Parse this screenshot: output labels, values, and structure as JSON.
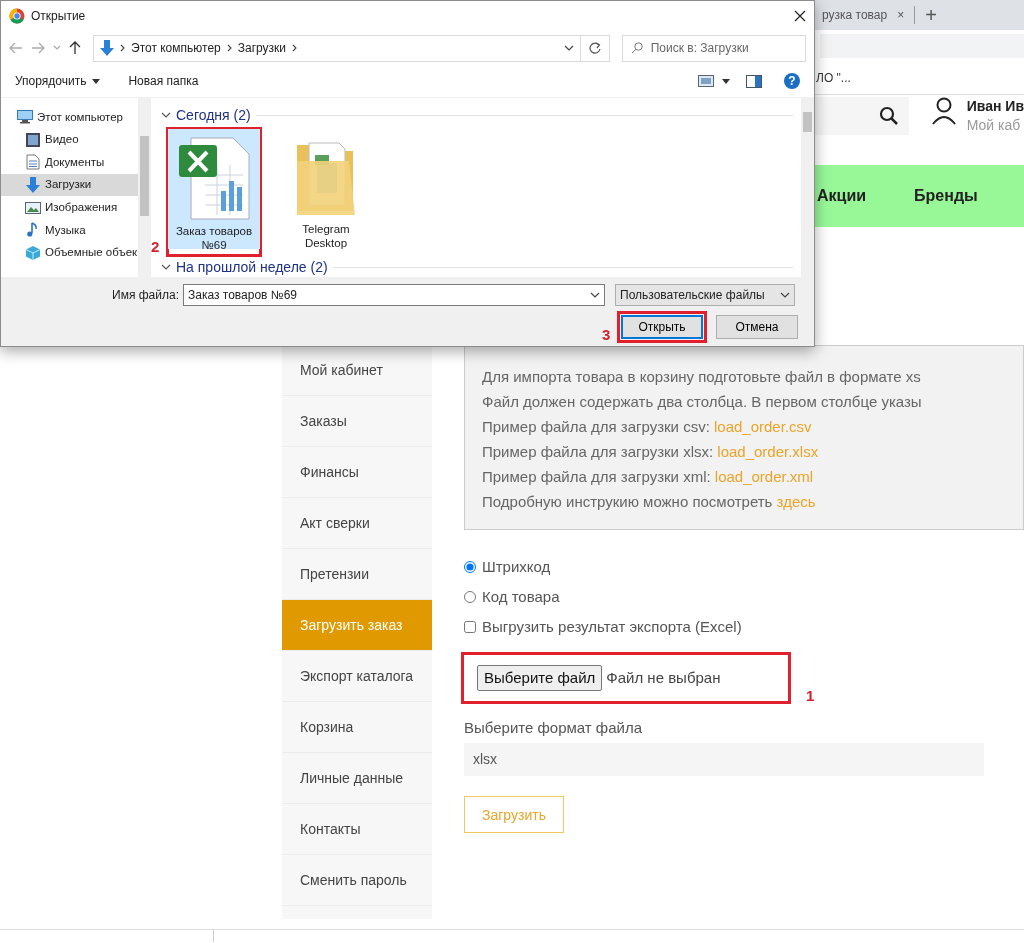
{
  "browser": {
    "tab_title": "рузка товар",
    "tab_close": "×",
    "new_tab": "+",
    "bookmark": "ЛО \"..."
  },
  "header": {
    "user_name": "Иван Ив",
    "user_link": "Мой каб"
  },
  "nav": [
    {
      "label": "Акции"
    },
    {
      "label": "Бренды"
    }
  ],
  "sidebar": {
    "items": [
      {
        "label": "Мой кабинет",
        "selected": false
      },
      {
        "label": "Заказы",
        "selected": false
      },
      {
        "label": "Финансы",
        "selected": false
      },
      {
        "label": "Акт сверки",
        "selected": false
      },
      {
        "label": "Претензии",
        "selected": false
      },
      {
        "label": "Загрузить заказ",
        "selected": true
      },
      {
        "label": "Экспорт каталога",
        "selected": false
      },
      {
        "label": "Корзина",
        "selected": false
      },
      {
        "label": "Личные данные",
        "selected": false
      },
      {
        "label": "Контакты",
        "selected": false
      },
      {
        "label": "Сменить пароль",
        "selected": false
      }
    ]
  },
  "info": {
    "lines": [
      {
        "text": "Для импорта товара в корзину подготовьте файл в формате xs"
      },
      {
        "text": "Файл должен содержать два столбца. В первом столбце указы"
      },
      {
        "text": "Пример файла для загрузки csv: ",
        "link": "load_order.csv"
      },
      {
        "text": "Пример файла для загрузки xlsx: ",
        "link": "load_order.xlsx"
      },
      {
        "text": "Пример файла для загрузки xml: ",
        "link": "load_order.xml"
      },
      {
        "text": "Подробную инструкию можно посмотреть ",
        "link": "здесь"
      }
    ]
  },
  "options": [
    {
      "kind": "radio",
      "label": "Штрихкод",
      "checked": true
    },
    {
      "kind": "radio",
      "label": "Код товара",
      "checked": false
    },
    {
      "kind": "checkbox",
      "label": "Выгрузить результат экспорта (Excel)",
      "checked": false
    }
  ],
  "file_input": {
    "button": "Выберите файл",
    "status": "Файл не выбран",
    "highlight": "1"
  },
  "format": {
    "label": "Выберите формат файла",
    "value": "xlsx"
  },
  "submit": "Загрузить",
  "dialog": {
    "title": "Открытие",
    "path": [
      "Этот компьютер",
      "Загрузки"
    ],
    "search_placeholder": "Поиск в: Загрузки",
    "toolbar": {
      "organize": "Упорядочить",
      "new_folder": "Новая папка",
      "help": "?"
    },
    "nav_pane": [
      {
        "label": "Этот компьютер",
        "kind": "computer",
        "selected": false
      },
      {
        "label": "Видео",
        "kind": "video",
        "selected": false
      },
      {
        "label": "Документы",
        "kind": "documents",
        "selected": false
      },
      {
        "label": "Загрузки",
        "kind": "downloads",
        "selected": true
      },
      {
        "label": "Изображения",
        "kind": "pictures",
        "selected": false
      },
      {
        "label": "Музыка",
        "kind": "music",
        "selected": false
      },
      {
        "label": "Объемные объек",
        "kind": "objects",
        "selected": false
      }
    ],
    "groups": [
      {
        "title": "Сегодня (2)",
        "files": [
          {
            "name": "Заказ товаров №69",
            "kind": "excel",
            "selected": true,
            "highlight": "2"
          },
          {
            "name": "Telegram Desktop",
            "kind": "folder",
            "selected": false
          }
        ]
      },
      {
        "title": "На прошлой неделе (2)"
      }
    ],
    "filename_label": "Имя файла:",
    "filename": "Заказ товаров №69",
    "filetype": "Пользовательские файлы",
    "buttons": [
      {
        "label": "Открыть",
        "default": true,
        "highlight": "3"
      },
      {
        "label": "Отмена",
        "default": false
      }
    ]
  }
}
